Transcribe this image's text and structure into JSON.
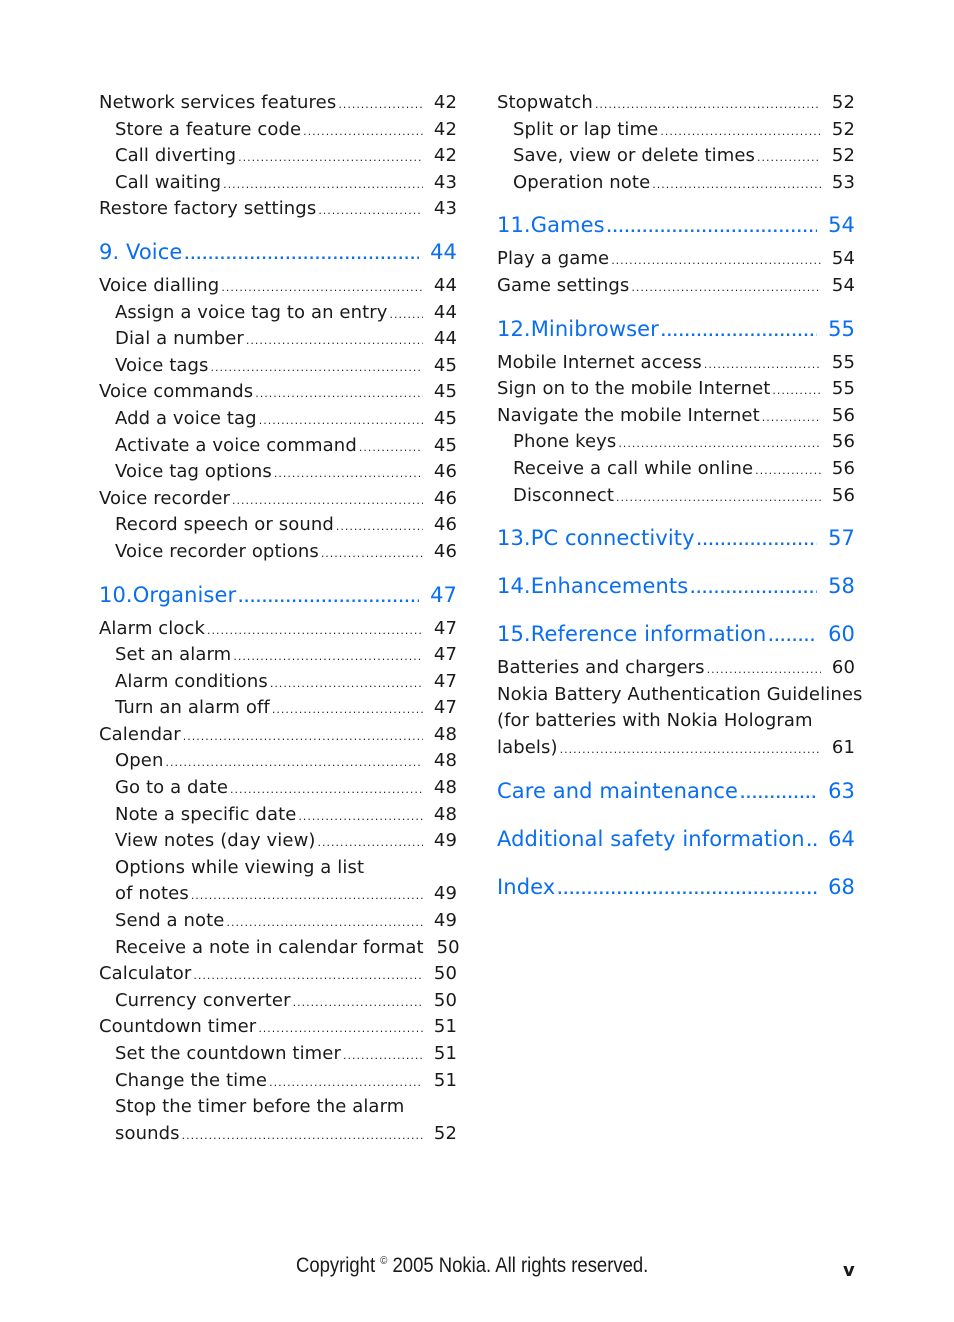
{
  "left_column": [
    {
      "level": 2,
      "text": "Network services features",
      "page": "42"
    },
    {
      "level": 3,
      "text": "Store a feature code",
      "page": "42"
    },
    {
      "level": 3,
      "text": "Call diverting",
      "page": "42"
    },
    {
      "level": 3,
      "text": "Call waiting",
      "page": "43"
    },
    {
      "level": 2,
      "text": "Restore factory settings",
      "page": "43"
    },
    {
      "level": 1,
      "text": "9. Voice",
      "page": "44"
    },
    {
      "level": 2,
      "text": "Voice dialling",
      "page": "44"
    },
    {
      "level": 3,
      "text": "Assign a voice tag to an entry",
      "page": "44"
    },
    {
      "level": 3,
      "text": "Dial a number",
      "page": "44"
    },
    {
      "level": 3,
      "text": "Voice tags",
      "page": "45"
    },
    {
      "level": 2,
      "text": "Voice commands",
      "page": "45"
    },
    {
      "level": 3,
      "text": "Add a voice tag",
      "page": "45"
    },
    {
      "level": 3,
      "text": "Activate a voice command",
      "page": "45"
    },
    {
      "level": 3,
      "text": "Voice tag options",
      "page": "46"
    },
    {
      "level": 2,
      "text": "Voice recorder",
      "page": "46"
    },
    {
      "level": 3,
      "text": "Record speech or sound",
      "page": "46"
    },
    {
      "level": 3,
      "text": "Voice recorder options",
      "page": "46"
    },
    {
      "level": 1,
      "text": "10.Organiser",
      "page": "47"
    },
    {
      "level": 2,
      "text": "Alarm clock",
      "page": "47"
    },
    {
      "level": 3,
      "text": "Set an alarm",
      "page": "47"
    },
    {
      "level": 3,
      "text": "Alarm conditions",
      "page": "47"
    },
    {
      "level": 3,
      "text": "Turn an alarm off",
      "page": "47"
    },
    {
      "level": 2,
      "text": "Calendar",
      "page": "48"
    },
    {
      "level": 3,
      "text": "Open",
      "page": "48"
    },
    {
      "level": 3,
      "text": "Go to a date",
      "page": "48"
    },
    {
      "level": 3,
      "text": "Note a specific date",
      "page": "48"
    },
    {
      "level": 3,
      "text": "View notes (day view)",
      "page": "49"
    },
    {
      "level": 3,
      "text": "Options while viewing a list",
      "page": "",
      "wrap": true
    },
    {
      "level": 3,
      "text": "of notes",
      "page": "49"
    },
    {
      "level": 3,
      "text": "Send a note",
      "page": "49"
    },
    {
      "level": 3,
      "text": "Receive a note in calendar format",
      "page": "50"
    },
    {
      "level": 2,
      "text": "Calculator",
      "page": "50"
    },
    {
      "level": 3,
      "text": "Currency converter",
      "page": "50"
    },
    {
      "level": 2,
      "text": "Countdown timer",
      "page": "51"
    },
    {
      "level": 3,
      "text": "Set the countdown timer",
      "page": "51"
    },
    {
      "level": 3,
      "text": "Change the time",
      "page": "51"
    },
    {
      "level": 3,
      "text": "Stop the timer before the alarm",
      "page": "",
      "wrap": true
    },
    {
      "level": 3,
      "text": "sounds",
      "page": "52"
    }
  ],
  "right_column": [
    {
      "level": 2,
      "text": "Stopwatch",
      "page": "52"
    },
    {
      "level": 3,
      "text": "Split or lap time",
      "page": "52"
    },
    {
      "level": 3,
      "text": "Save, view or delete times",
      "page": "52"
    },
    {
      "level": 3,
      "text": "Operation note",
      "page": "53"
    },
    {
      "level": 1,
      "text": "11.Games",
      "page": "54"
    },
    {
      "level": 2,
      "text": "Play a game",
      "page": "54"
    },
    {
      "level": 2,
      "text": "Game settings",
      "page": "54"
    },
    {
      "level": 1,
      "text": "12.Minibrowser",
      "page": "55"
    },
    {
      "level": 2,
      "text": "Mobile Internet access",
      "page": "55"
    },
    {
      "level": 2,
      "text": "Sign on to the mobile Internet",
      "page": "55"
    },
    {
      "level": 2,
      "text": "Navigate the mobile Internet",
      "page": "56"
    },
    {
      "level": 3,
      "text": "Phone keys",
      "page": "56"
    },
    {
      "level": 3,
      "text": "Receive a call while online",
      "page": "56"
    },
    {
      "level": 3,
      "text": "Disconnect",
      "page": "56"
    },
    {
      "level": 1,
      "text": "13.PC connectivity",
      "page": "57"
    },
    {
      "level": 1,
      "text": "14.Enhancements",
      "page": "58"
    },
    {
      "level": 1,
      "text": "15.Reference information",
      "page": "60"
    },
    {
      "level": 2,
      "text": "Batteries and chargers",
      "page": "60"
    },
    {
      "level": 2,
      "text": "Nokia Battery Authentication Guidelines",
      "page": "",
      "wrap": true
    },
    {
      "level": 2,
      "text": "(for batteries with Nokia Hologram",
      "page": "",
      "wrap": true
    },
    {
      "level": 2,
      "text": "labels)",
      "page": "61"
    },
    {
      "level": 1,
      "text": "Care and maintenance",
      "page": "63"
    },
    {
      "level": 1,
      "text": "Additional safety information",
      "page": "64"
    },
    {
      "level": 1,
      "text": "Index",
      "page": "68"
    }
  ],
  "footer": {
    "copyright_prefix": "Copyright",
    "copyright_symbol": "©",
    "copyright_suffix": "2005 Nokia. All rights reserved.",
    "page_number": "v"
  },
  "colors": {
    "heading": "#0a6ef0",
    "text": "#1a1a1a"
  }
}
